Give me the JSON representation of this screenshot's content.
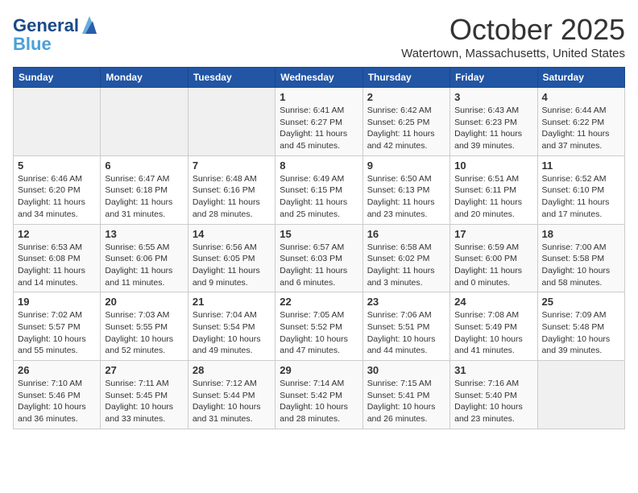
{
  "header": {
    "logo_line1": "General",
    "logo_line2": "Blue",
    "month": "October 2025",
    "location": "Watertown, Massachusetts, United States"
  },
  "weekdays": [
    "Sunday",
    "Monday",
    "Tuesday",
    "Wednesday",
    "Thursday",
    "Friday",
    "Saturday"
  ],
  "weeks": [
    [
      {
        "day": "",
        "info": ""
      },
      {
        "day": "",
        "info": ""
      },
      {
        "day": "",
        "info": ""
      },
      {
        "day": "1",
        "info": "Sunrise: 6:41 AM\nSunset: 6:27 PM\nDaylight: 11 hours and 45 minutes."
      },
      {
        "day": "2",
        "info": "Sunrise: 6:42 AM\nSunset: 6:25 PM\nDaylight: 11 hours and 42 minutes."
      },
      {
        "day": "3",
        "info": "Sunrise: 6:43 AM\nSunset: 6:23 PM\nDaylight: 11 hours and 39 minutes."
      },
      {
        "day": "4",
        "info": "Sunrise: 6:44 AM\nSunset: 6:22 PM\nDaylight: 11 hours and 37 minutes."
      }
    ],
    [
      {
        "day": "5",
        "info": "Sunrise: 6:46 AM\nSunset: 6:20 PM\nDaylight: 11 hours and 34 minutes."
      },
      {
        "day": "6",
        "info": "Sunrise: 6:47 AM\nSunset: 6:18 PM\nDaylight: 11 hours and 31 minutes."
      },
      {
        "day": "7",
        "info": "Sunrise: 6:48 AM\nSunset: 6:16 PM\nDaylight: 11 hours and 28 minutes."
      },
      {
        "day": "8",
        "info": "Sunrise: 6:49 AM\nSunset: 6:15 PM\nDaylight: 11 hours and 25 minutes."
      },
      {
        "day": "9",
        "info": "Sunrise: 6:50 AM\nSunset: 6:13 PM\nDaylight: 11 hours and 23 minutes."
      },
      {
        "day": "10",
        "info": "Sunrise: 6:51 AM\nSunset: 6:11 PM\nDaylight: 11 hours and 20 minutes."
      },
      {
        "day": "11",
        "info": "Sunrise: 6:52 AM\nSunset: 6:10 PM\nDaylight: 11 hours and 17 minutes."
      }
    ],
    [
      {
        "day": "12",
        "info": "Sunrise: 6:53 AM\nSunset: 6:08 PM\nDaylight: 11 hours and 14 minutes."
      },
      {
        "day": "13",
        "info": "Sunrise: 6:55 AM\nSunset: 6:06 PM\nDaylight: 11 hours and 11 minutes."
      },
      {
        "day": "14",
        "info": "Sunrise: 6:56 AM\nSunset: 6:05 PM\nDaylight: 11 hours and 9 minutes."
      },
      {
        "day": "15",
        "info": "Sunrise: 6:57 AM\nSunset: 6:03 PM\nDaylight: 11 hours and 6 minutes."
      },
      {
        "day": "16",
        "info": "Sunrise: 6:58 AM\nSunset: 6:02 PM\nDaylight: 11 hours and 3 minutes."
      },
      {
        "day": "17",
        "info": "Sunrise: 6:59 AM\nSunset: 6:00 PM\nDaylight: 11 hours and 0 minutes."
      },
      {
        "day": "18",
        "info": "Sunrise: 7:00 AM\nSunset: 5:58 PM\nDaylight: 10 hours and 58 minutes."
      }
    ],
    [
      {
        "day": "19",
        "info": "Sunrise: 7:02 AM\nSunset: 5:57 PM\nDaylight: 10 hours and 55 minutes."
      },
      {
        "day": "20",
        "info": "Sunrise: 7:03 AM\nSunset: 5:55 PM\nDaylight: 10 hours and 52 minutes."
      },
      {
        "day": "21",
        "info": "Sunrise: 7:04 AM\nSunset: 5:54 PM\nDaylight: 10 hours and 49 minutes."
      },
      {
        "day": "22",
        "info": "Sunrise: 7:05 AM\nSunset: 5:52 PM\nDaylight: 10 hours and 47 minutes."
      },
      {
        "day": "23",
        "info": "Sunrise: 7:06 AM\nSunset: 5:51 PM\nDaylight: 10 hours and 44 minutes."
      },
      {
        "day": "24",
        "info": "Sunrise: 7:08 AM\nSunset: 5:49 PM\nDaylight: 10 hours and 41 minutes."
      },
      {
        "day": "25",
        "info": "Sunrise: 7:09 AM\nSunset: 5:48 PM\nDaylight: 10 hours and 39 minutes."
      }
    ],
    [
      {
        "day": "26",
        "info": "Sunrise: 7:10 AM\nSunset: 5:46 PM\nDaylight: 10 hours and 36 minutes."
      },
      {
        "day": "27",
        "info": "Sunrise: 7:11 AM\nSunset: 5:45 PM\nDaylight: 10 hours and 33 minutes."
      },
      {
        "day": "28",
        "info": "Sunrise: 7:12 AM\nSunset: 5:44 PM\nDaylight: 10 hours and 31 minutes."
      },
      {
        "day": "29",
        "info": "Sunrise: 7:14 AM\nSunset: 5:42 PM\nDaylight: 10 hours and 28 minutes."
      },
      {
        "day": "30",
        "info": "Sunrise: 7:15 AM\nSunset: 5:41 PM\nDaylight: 10 hours and 26 minutes."
      },
      {
        "day": "31",
        "info": "Sunrise: 7:16 AM\nSunset: 5:40 PM\nDaylight: 10 hours and 23 minutes."
      },
      {
        "day": "",
        "info": ""
      }
    ]
  ]
}
